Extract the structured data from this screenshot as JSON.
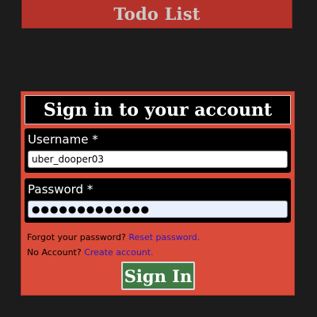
{
  "header": {
    "title": "Todo List"
  },
  "signin": {
    "title": "Sign in to your account",
    "username": {
      "label": "Username *",
      "value": "uber_dooper03"
    },
    "password": {
      "label": "Password *",
      "value": "●●●●●●●●●●●●●"
    },
    "forgot": {
      "prompt": "Forgot your password? ",
      "link": "Reset password."
    },
    "no_account": {
      "prompt": "No Account? ",
      "link": "Create account."
    },
    "submit_label": "Sign In"
  },
  "colors": {
    "page_background": "#1c1c1c",
    "header_background": "#b5322a",
    "card_background": "#db4b3a",
    "field_background": "#000000",
    "link_color": "#2a1ab8",
    "button_background": "#3f7a45"
  }
}
